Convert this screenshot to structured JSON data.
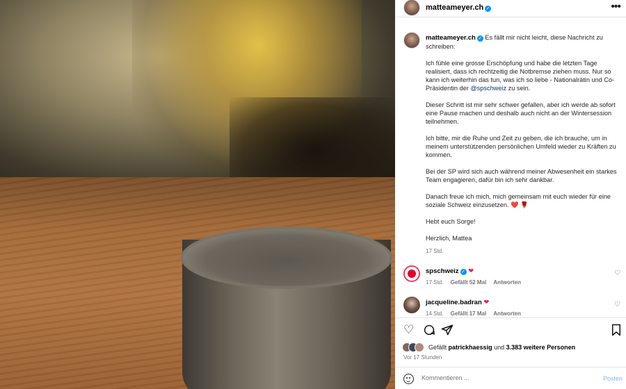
{
  "header": {
    "username": "matteameyer.ch",
    "more_icon": "more-horizontal-icon"
  },
  "caption": {
    "username": "matteameyer.ch",
    "intro": "Es fällt mir nicht leicht, diese Nachricht zu schreiben:",
    "p1_before": "Ich fühle eine grosse Erschöpfung und habe die letzten Tage realisiert, dass ich rechtzeitig die Notbremse ziehen muss. Nur so kann ich weiterhin das tun, was ich so liebe - Nationalrätin und Co-Präsidentin der ",
    "p1_mention": "@spschweiz",
    "p1_after": " zu sein.",
    "p2": "Dieser Schritt ist mir sehr schwer gefallen, aber ich werde ab sofort eine Pause machen und deshalb auch nicht an der Wintersession teilnehmen.",
    "p3": "Ich bitte, mir die Ruhe und Zeit zu geben, die ich brauche, um in meinem unterstützenden persönlichen Umfeld wieder zu Kräften zu kommen.",
    "p4": "Bei der SP wird sich auch während meiner Abwesenheit ein starkes Team engagieren, dafür bin ich sehr dankbar.",
    "p5": "Danach freue ich mich, mich gemeinsam mit euch wieder für eine soziale Schweiz einzusetzen.",
    "p5_emoji": "❤️ 🌹",
    "p6": "Hebt euch Sorge!",
    "p7": "Herzlich, Mattea",
    "time": "17 Std."
  },
  "comments": [
    {
      "username": "spschweiz",
      "text": "❤",
      "time": "17 Std.",
      "likes": "Gefällt 52 Mal",
      "reply": "Antworten"
    },
    {
      "username": "jacqueline.badran",
      "text": "❤",
      "time": "14 Std.",
      "likes": "Gefällt 17 Mal",
      "reply": "Antworten"
    }
  ],
  "likes": {
    "prefix": "Gefällt",
    "user": "patrickhaessig",
    "middle": "und",
    "others": "3.383 weitere Personen",
    "ago": "Vor 17 Stunden"
  },
  "add_comment": {
    "placeholder": "Kommentieren ...",
    "post": "Posten"
  },
  "colors": {
    "accent": "#0095f6",
    "mention": "#00376b",
    "heart": "#e0245e"
  }
}
